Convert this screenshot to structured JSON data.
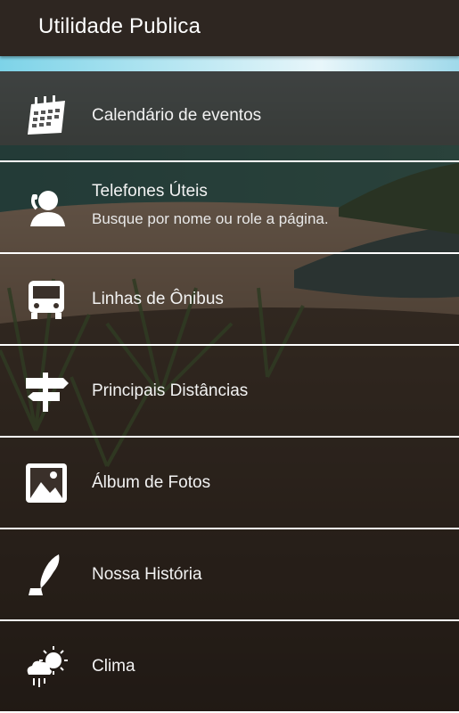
{
  "app_bar": {
    "title": "Utilidade Publica"
  },
  "menu": [
    {
      "label": "Calendário de eventos",
      "icon": "calendar-icon"
    },
    {
      "label": "Telefones Úteis",
      "sub": "Busque por nome ou role a página.",
      "icon": "phone-operator-icon"
    },
    {
      "label": "Linhas de Ônibus",
      "icon": "bus-icon"
    },
    {
      "label": "Principais Distâncias",
      "icon": "signpost-icon"
    },
    {
      "label": "Álbum de Fotos",
      "icon": "photo-album-icon"
    },
    {
      "label": "Nossa História",
      "icon": "quill-inkpot-icon"
    },
    {
      "label": "Clima",
      "icon": "weather-icon"
    }
  ],
  "colors": {
    "app_bar": "#2e2621",
    "item_overlay": "#191410",
    "divider": "#ffffff",
    "text": "#f2f2f2"
  }
}
